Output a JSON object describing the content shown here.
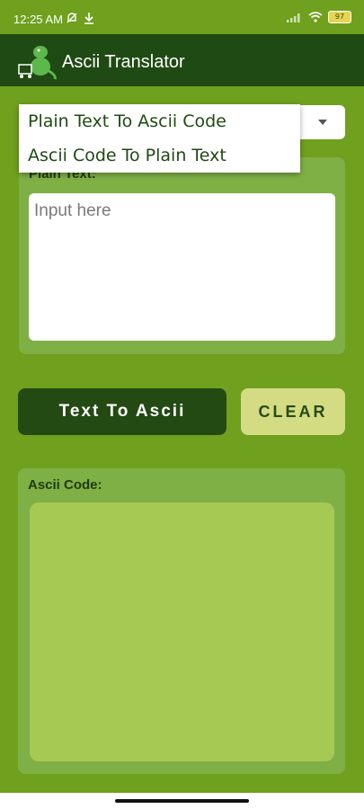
{
  "status_bar": {
    "time": "12:25 AM",
    "icons": [
      "mute-bell-icon",
      "download-icon",
      "signal-icon",
      "wifi-icon"
    ],
    "battery": "97"
  },
  "app_bar": {
    "title": "Ascii Translator",
    "logo": "dinosaur-logo-icon"
  },
  "spinner": {
    "options": [
      "Plain Text To Ascii Code",
      "Ascii Code To Plain Text"
    ]
  },
  "plain_panel": {
    "label": "Plain Text:",
    "placeholder": "Input here"
  },
  "buttons": {
    "convert": "Text To Ascii",
    "clear": "CLEAR"
  },
  "ascii_panel": {
    "label": "Ascii Code:",
    "value": ""
  },
  "colors": {
    "background": "#6fa01e",
    "app_bar": "#1f4a13",
    "panel": "#7fb045",
    "primary_button": "#234a13",
    "secondary_button": "#d3dc82",
    "output_field": "#a6c954"
  }
}
